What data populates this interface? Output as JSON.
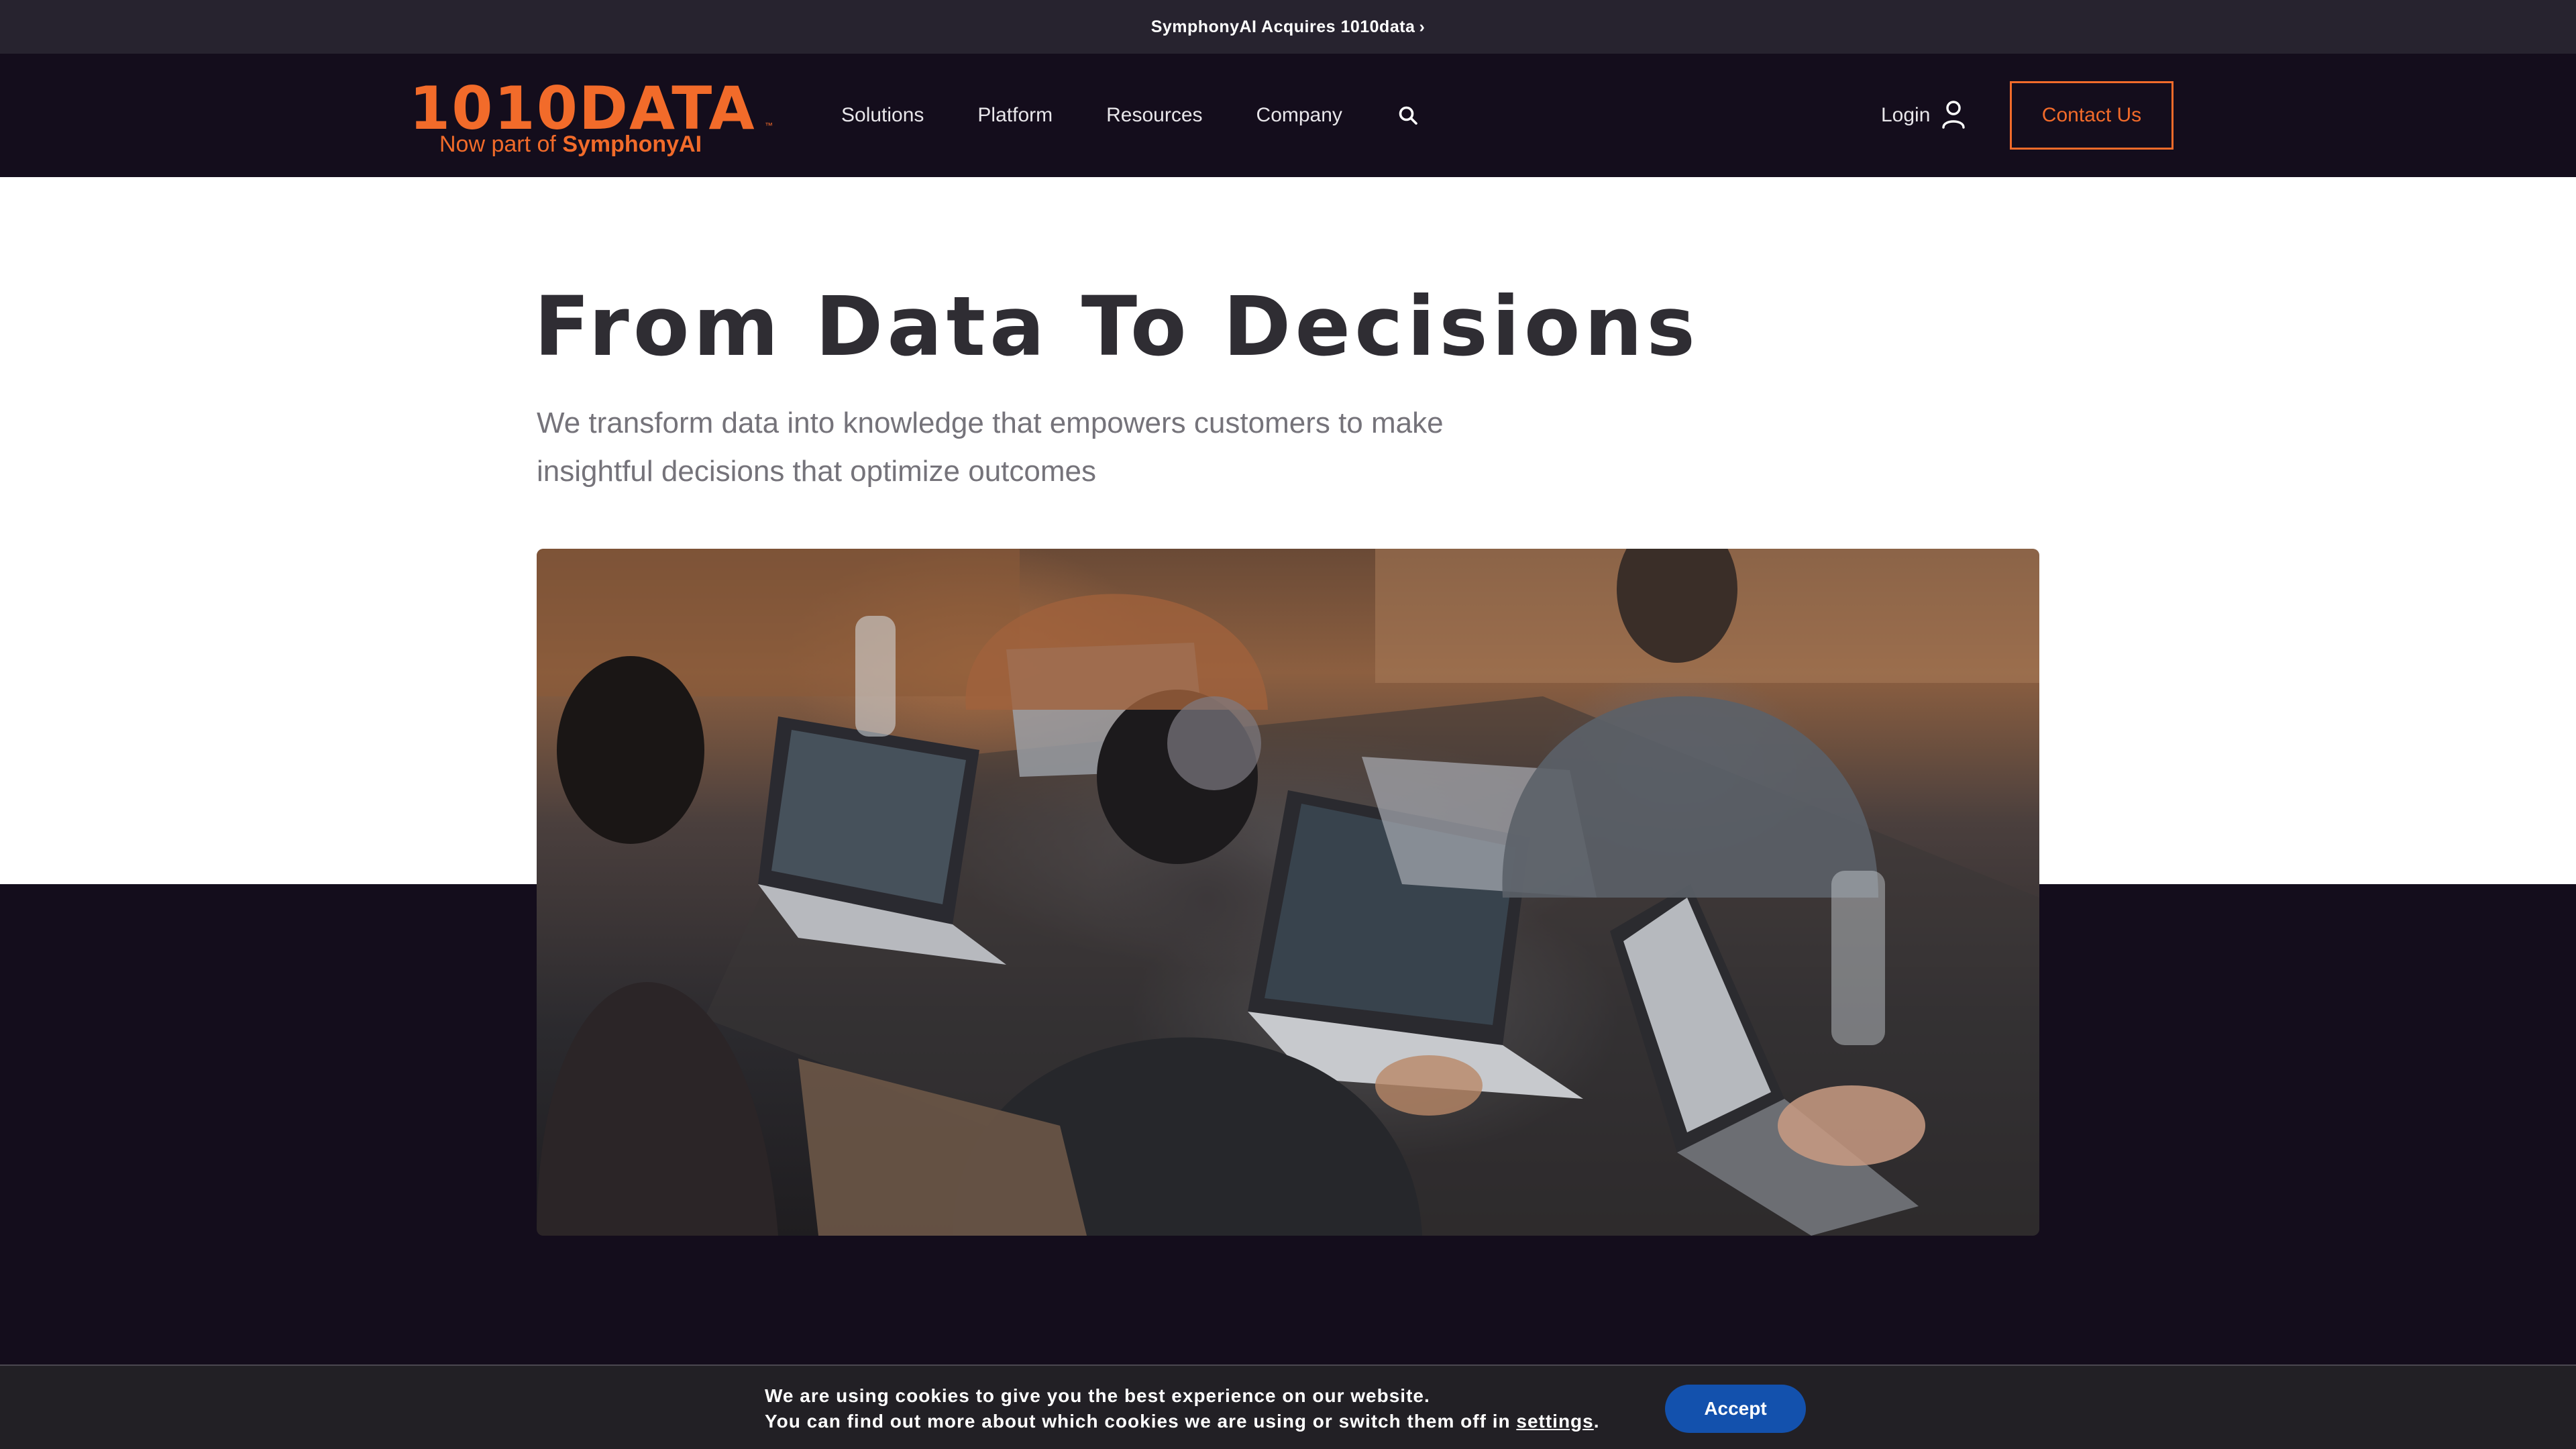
{
  "announcement": {
    "text": "SymphonyAI Acquires 1010data",
    "chevron": "›"
  },
  "logo": {
    "main": "1010DATA",
    "tm": "™",
    "sub_prefix": "Now part of ",
    "sub_brand": "SymphonyAI"
  },
  "nav": {
    "items": [
      {
        "label": "Solutions"
      },
      {
        "label": "Platform"
      },
      {
        "label": "Resources"
      },
      {
        "label": "Company"
      }
    ],
    "search_icon": "search-icon"
  },
  "header_actions": {
    "login_label": "Login",
    "login_icon": "user-icon",
    "contact_label": "Contact Us"
  },
  "hero": {
    "title": "From Data To Decisions",
    "subtitle": "We transform data into knowledge that empowers customers to make insightful decisions that optimize outcomes"
  },
  "cookie": {
    "line1": "We are using cookies to give you the best experience on our website.",
    "line2_prefix": "You can find out more about which cookies we are using or switch them off in ",
    "line2_link": "settings",
    "line2_suffix": ".",
    "accept_label": "Accept"
  },
  "colors": {
    "accent": "#f26b2a",
    "header_bg": "#140d1c",
    "announce_bg": "#27232f",
    "accept_bg": "#1351ad"
  }
}
